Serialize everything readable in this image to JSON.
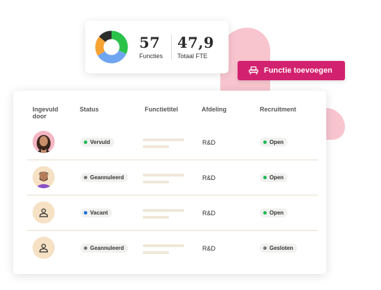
{
  "colors": {
    "accent": "#d2226f",
    "blob": "#f8c5cf",
    "green": "#1db954",
    "blue": "#1f6fd6",
    "grey": "#777777",
    "avatar_bg": "#f6e1c5"
  },
  "stats": {
    "functies_value": "57",
    "functies_label": "Functies",
    "fte_value": "47,9",
    "fte_label": "Totaal FTE",
    "donut": [
      {
        "color": "#2bc24a",
        "value": 0.32
      },
      {
        "color": "#6fa5f0",
        "value": 0.34
      },
      {
        "color": "#f6a334",
        "value": 0.2
      },
      {
        "color": "#2e2e2e",
        "value": 0.14
      }
    ]
  },
  "add_button": {
    "label": "Functie toevoegen",
    "icon": "armchair-icon"
  },
  "table": {
    "headers": [
      "Ingevuld door",
      "Status",
      "Functietitel",
      "Afdeling",
      "Recruitment"
    ],
    "rows": [
      {
        "avatar": "photo-woman",
        "status": "Vervuld",
        "status_color": "#1db954",
        "afdeling": "R&D",
        "recruitment": "Open",
        "recruitment_color": "#1db954"
      },
      {
        "avatar": "photo-man",
        "status": "Geannuleerd",
        "status_color": "#777777",
        "afdeling": "R&D",
        "recruitment": "Open",
        "recruitment_color": "#1db954"
      },
      {
        "avatar": "user-icon",
        "status": "Vacant",
        "status_color": "#1f6fd6",
        "afdeling": "R&D",
        "recruitment": "Open",
        "recruitment_color": "#1db954"
      },
      {
        "avatar": "user-icon",
        "status": "Geannuleerd",
        "status_color": "#777777",
        "afdeling": "R&D",
        "recruitment": "Gesloten",
        "recruitment_color": "#777777"
      }
    ]
  }
}
